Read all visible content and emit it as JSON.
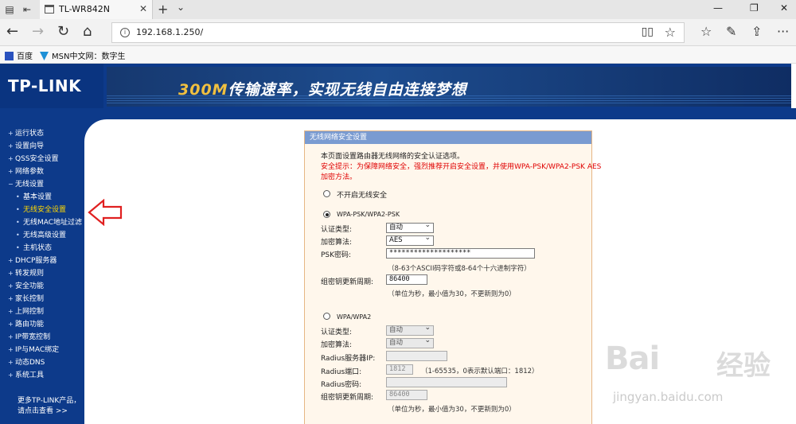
{
  "browser": {
    "tab_title": "TL-WR842N",
    "url": "192.168.1.250/",
    "favorites": [
      "百度",
      "MSN中文网：数字生"
    ]
  },
  "banner": {
    "logo": "TP-LINK",
    "slogan_highlight": "300M",
    "slogan_rest": "传输速率，实现无线自由连接梦想"
  },
  "menu": [
    {
      "label": "运行状态",
      "sub": false,
      "active": false
    },
    {
      "label": "设置向导",
      "sub": false,
      "active": false
    },
    {
      "label": "QSS安全设置",
      "sub": false,
      "active": false
    },
    {
      "label": "网络参数",
      "sub": false,
      "active": false
    },
    {
      "label": "无线设置",
      "sub": false,
      "active": false
    },
    {
      "label": "基本设置",
      "sub": true,
      "active": false
    },
    {
      "label": "无线安全设置",
      "sub": true,
      "active": true
    },
    {
      "label": "无线MAC地址过滤",
      "sub": true,
      "active": false
    },
    {
      "label": "无线高级设置",
      "sub": true,
      "active": false
    },
    {
      "label": "主机状态",
      "sub": true,
      "active": false
    },
    {
      "label": "DHCP服务器",
      "sub": false,
      "active": false
    },
    {
      "label": "转发规则",
      "sub": false,
      "active": false
    },
    {
      "label": "安全功能",
      "sub": false,
      "active": false
    },
    {
      "label": "家长控制",
      "sub": false,
      "active": false
    },
    {
      "label": "上网控制",
      "sub": false,
      "active": false
    },
    {
      "label": "路由功能",
      "sub": false,
      "active": false
    },
    {
      "label": "IP带宽控制",
      "sub": false,
      "active": false
    },
    {
      "label": "IP与MAC绑定",
      "sub": false,
      "active": false
    },
    {
      "label": "动态DNS",
      "sub": false,
      "active": false
    },
    {
      "label": "系统工具",
      "sub": false,
      "active": false
    }
  ],
  "more": {
    "line1": "更多TP-LINK产品，",
    "line2": "请点击查看 >>"
  },
  "panel": {
    "title": "无线网络安全设置",
    "intro": "本页面设置路由器无线网络的安全认证选项。",
    "warn1": "安全提示：为保障网络安全，强烈推荐开启安全设置，并使用WPA-PSK/WPA2-PSK AES",
    "warn2": "加密方法。",
    "opt_none": "不开启无线安全",
    "opt_psk": "WPA-PSK/WPA2-PSK",
    "opt_wpa": "WPA/WPA2",
    "auth_label": "认证类型:",
    "enc_label": "加密算法:",
    "psk_label": "PSK密码:",
    "rekey_label": "组密钥更新周期:",
    "psk_auth_value": "自动",
    "psk_enc_value": "AES",
    "psk_password": "********************",
    "psk_hint": "（8-63个ASCII码字符或8-64个十六进制字符）",
    "psk_rekey_value": "86400",
    "rekey_hint": "（单位为秒，最小值为30，不更新则为0）",
    "wpa_auth_value": "自动",
    "wpa_enc_value": "自动",
    "radius_ip_label": "Radius服务器IP:",
    "radius_port_label": "Radius端口:",
    "radius_port_value": "1812",
    "radius_port_hint": "（1-65535，0表示默认端口：1812）",
    "radius_pwd_label": "Radius密码:",
    "wpa_rekey_value": "86400",
    "wpa_rekey_hint": "（单位为秒，最小值为30，不更新则为0）"
  },
  "watermark": {
    "word": "Bai",
    "cn": "经验",
    "sub": "jingyan.baidu.com"
  }
}
